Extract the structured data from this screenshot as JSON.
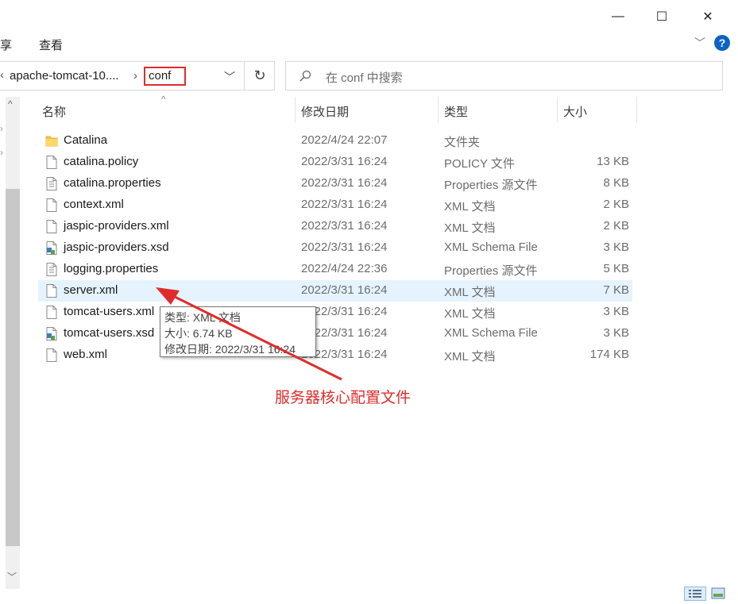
{
  "window": {
    "minimize_glyph": "—",
    "maximize_glyph": "☐",
    "close_glyph": "✕"
  },
  "ribbon": {
    "tab_share": "享",
    "tab_view": "查看",
    "expand_glyph": "﹀",
    "help_glyph": "?"
  },
  "address": {
    "back_glyph": "‹",
    "path_parent": "apache-tomcat-10....",
    "separator_glyph": "›",
    "current_folder": "conf",
    "dropdown_glyph": "﹀",
    "refresh_glyph": "↻"
  },
  "search": {
    "placeholder": "在 conf 中搜索"
  },
  "columns": {
    "name": "名称",
    "date": "修改日期",
    "type": "类型",
    "size": "大小",
    "sort_glyph": "^"
  },
  "files": [
    {
      "name": "Catalina",
      "date": "2022/4/24 22:07",
      "type": "文件夹",
      "size": "",
      "icon": "folder-icon"
    },
    {
      "name": "catalina.policy",
      "date": "2022/3/31 16:24",
      "type": "POLICY 文件",
      "size": "13 KB",
      "icon": "file-icon"
    },
    {
      "name": "catalina.properties",
      "date": "2022/3/31 16:24",
      "type": "Properties 源文件",
      "size": "8 KB",
      "icon": "properties-file-icon"
    },
    {
      "name": "context.xml",
      "date": "2022/3/31 16:24",
      "type": "XML 文档",
      "size": "2 KB",
      "icon": "file-icon"
    },
    {
      "name": "jaspic-providers.xml",
      "date": "2022/3/31 16:24",
      "type": "XML 文档",
      "size": "2 KB",
      "icon": "file-icon"
    },
    {
      "name": "jaspic-providers.xsd",
      "date": "2022/3/31 16:24",
      "type": "XML Schema File",
      "size": "3 KB",
      "icon": "schema-file-icon"
    },
    {
      "name": "logging.properties",
      "date": "2022/4/24 22:36",
      "type": "Properties 源文件",
      "size": "5 KB",
      "icon": "properties-file-icon"
    },
    {
      "name": "server.xml",
      "date": "2022/3/31 16:24",
      "type": "XML 文档",
      "size": "7 KB",
      "icon": "file-icon"
    },
    {
      "name": "tomcat-users.xml",
      "date": "2022/3/31 16:24",
      "type": "XML 文档",
      "size": "3 KB",
      "icon": "file-icon"
    },
    {
      "name": "tomcat-users.xsd",
      "date": "2022/3/31 16:24",
      "type": "XML Schema File",
      "size": "3 KB",
      "icon": "schema-file-icon"
    },
    {
      "name": "web.xml",
      "date": "2022/3/31 16:24",
      "type": "XML 文档",
      "size": "174 KB",
      "icon": "file-icon"
    }
  ],
  "tooltip": {
    "type_line": "类型: XML 文档",
    "size_line": "大小: 6.74 KB",
    "date_line": "修改日期: 2022/3/31 16:24"
  },
  "annotation": {
    "text": "服务器核心配置文件",
    "color": "#e12b2b"
  },
  "scrollbar": {
    "up_glyph": "^",
    "down_glyph": "﹀"
  }
}
